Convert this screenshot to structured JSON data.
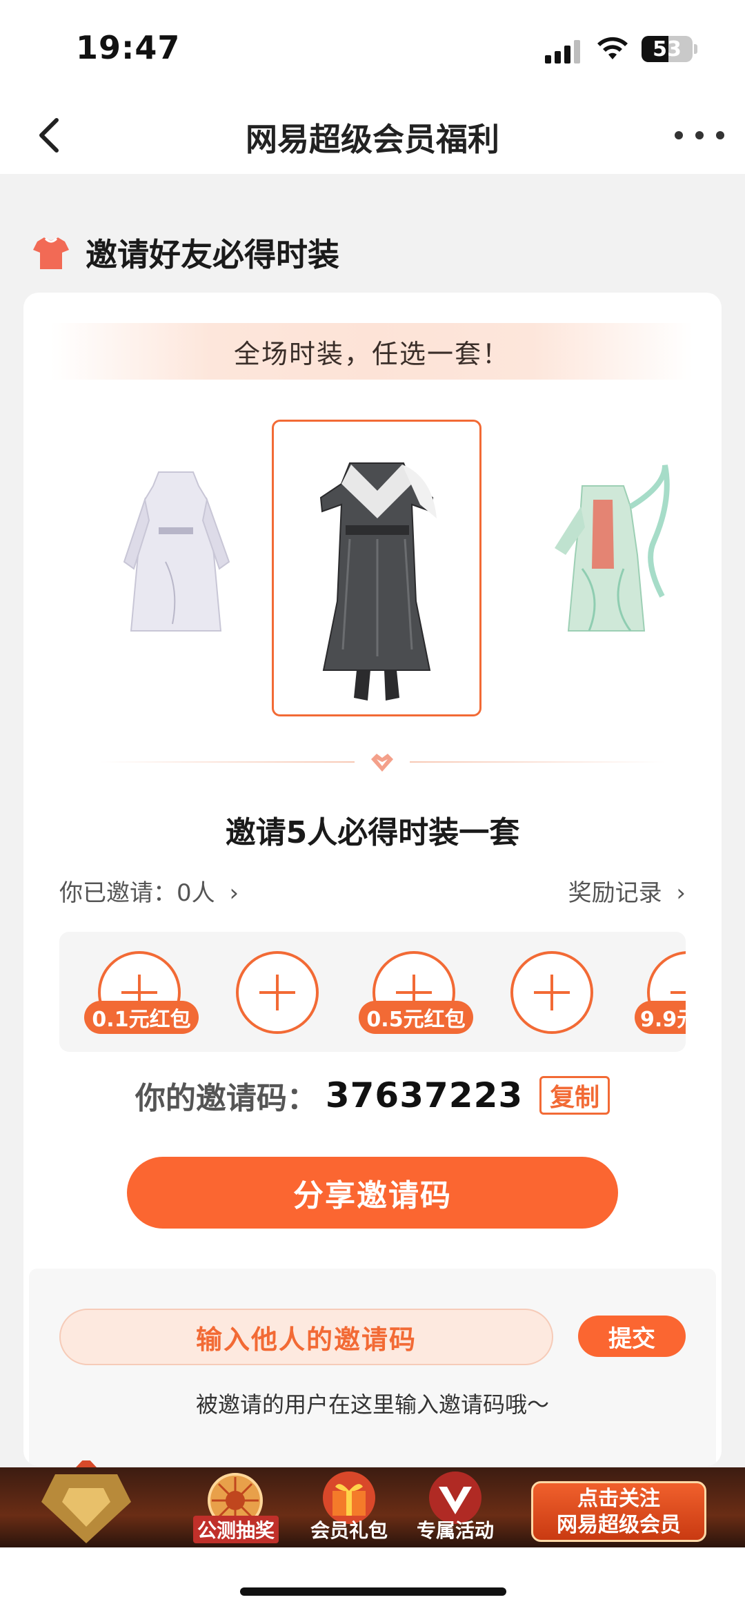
{
  "status_bar": {
    "time": "19:47",
    "battery": "53"
  },
  "nav": {
    "title": "网易超级会员福利",
    "back_icon": "chevron-left-icon",
    "more_icon": "more-dots-icon"
  },
  "section": {
    "title": "邀请好友必得时装",
    "icon": "tshirt-icon"
  },
  "banner": {
    "text": "全场时装，任选一套！"
  },
  "outfits": [
    {
      "icon": "white-robe-outfit-image"
    },
    {
      "icon": "dark-armor-outfit-image",
      "selected": true
    },
    {
      "icon": "green-dress-outfit-image"
    }
  ],
  "invite": {
    "goal": "邀请5人必得时装一套",
    "invited_label": "你已邀请：0人",
    "reward_record_label": "奖励记录",
    "slot_rewards": [
      "0.1元红包",
      "",
      "0.5元红包",
      "",
      "9.9元"
    ]
  },
  "code": {
    "label": "你的邀请码：",
    "value": "37637223",
    "copy_label": "复制"
  },
  "share": {
    "label": "分享邀请码"
  },
  "enter": {
    "placeholder": "输入他人的邀请码",
    "submit_label": "提交",
    "hint": "被邀请的用户在这里输入邀请码哦～"
  },
  "promo": {
    "items": [
      "公测抽奖",
      "会员礼包",
      "专属活动"
    ],
    "follow_label_line1": "点击关注",
    "follow_label_line2": "网易超级会员"
  },
  "colors": {
    "accent": "#fb6631",
    "accent_border": "#f26a35",
    "banner_bg": "#fde6db"
  }
}
